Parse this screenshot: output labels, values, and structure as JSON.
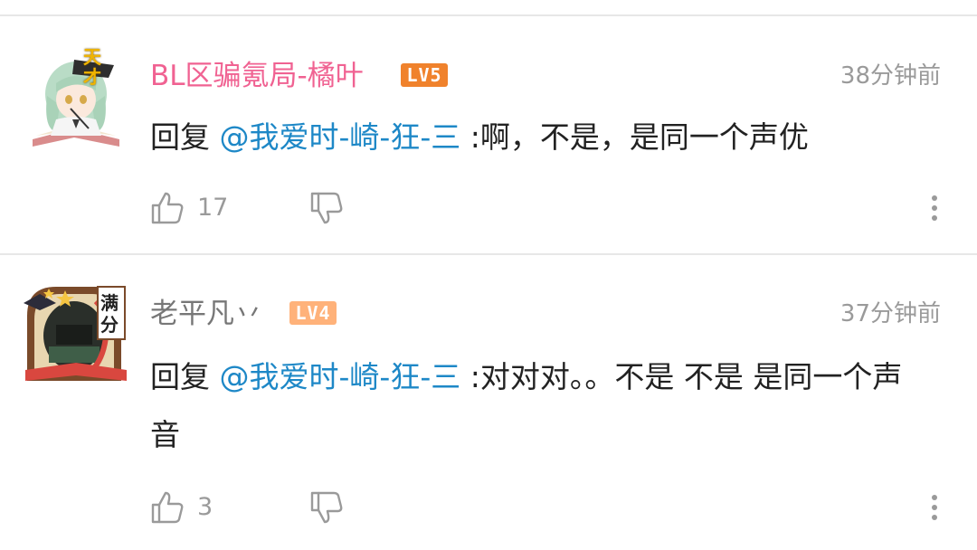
{
  "colors": {
    "vip_username": "#f06292",
    "normal_username": "#777777",
    "mention": "#1e88c7",
    "lv5_badge": "#f0822c",
    "lv4_badge": "#ffb27a",
    "meta_gray": "#9a9a9a"
  },
  "comments": [
    {
      "username": "BL区骗氪局-橘叶",
      "level": "LV5",
      "timestamp": "38分钟前",
      "reply_prefix": "回复",
      "mention": "@我爱时-崎-狂-三",
      "text": ":啊，不是，是同一个声优",
      "like_count": "17",
      "avatar_badge": "天才"
    },
    {
      "username": "老平凡丷",
      "level": "LV4",
      "timestamp": "37分钟前",
      "reply_prefix": "回复",
      "mention": "@我爱时-崎-狂-三",
      "text": ":对对对。。不是 不是 是同一个声音",
      "like_count": "3",
      "avatar_badge": "满分"
    }
  ],
  "icons": [
    "thumbs-up-icon",
    "thumbs-down-icon",
    "more-vertical-icon"
  ]
}
